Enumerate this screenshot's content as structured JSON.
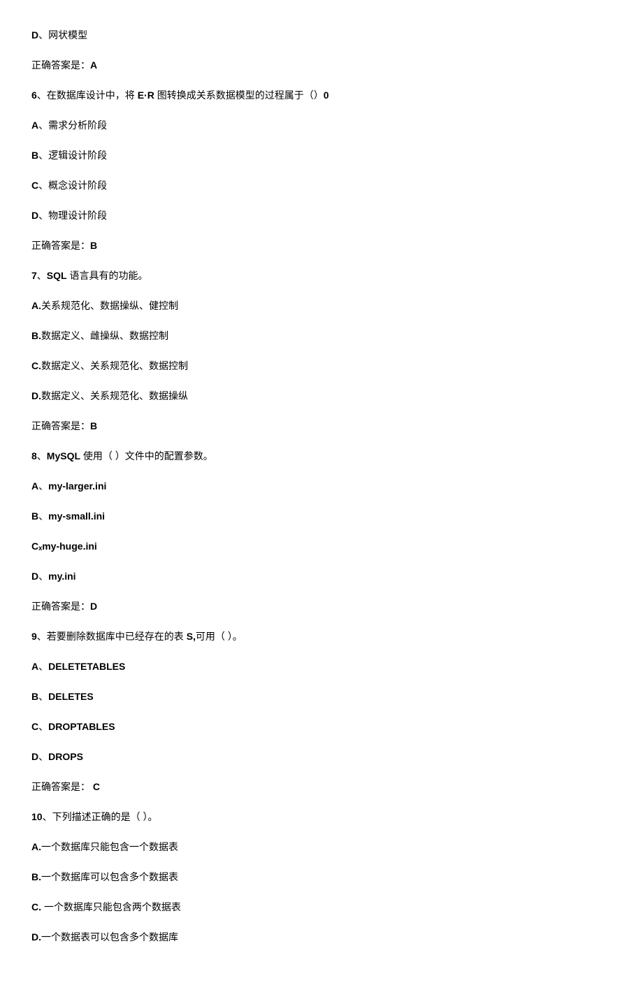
{
  "lines": [
    {
      "segments": [
        {
          "text": "D",
          "bold": true
        },
        {
          "text": "、网状模型"
        }
      ]
    },
    {
      "segments": [
        {
          "text": "正确答案是："
        },
        {
          "text": "A",
          "bold": true
        }
      ]
    },
    {
      "segments": [
        {
          "text": "6",
          "bold": true
        },
        {
          "text": "、在数据库设计中，将 "
        },
        {
          "text": "E·R",
          "bold": true
        },
        {
          "text": " 图转换成关系数据模型的过程属于（）"
        },
        {
          "text": "0",
          "bold": true
        }
      ]
    },
    {
      "segments": [
        {
          "text": "A",
          "bold": true
        },
        {
          "text": "、需求分析阶段"
        }
      ]
    },
    {
      "segments": [
        {
          "text": "B",
          "bold": true
        },
        {
          "text": "、逻辑设计阶段"
        }
      ]
    },
    {
      "segments": [
        {
          "text": "C",
          "bold": true
        },
        {
          "text": "、概念设计阶段"
        }
      ]
    },
    {
      "segments": [
        {
          "text": "D",
          "bold": true
        },
        {
          "text": "、物理设计阶段"
        }
      ]
    },
    {
      "segments": [
        {
          "text": "正确答案是："
        },
        {
          "text": "B",
          "bold": true
        }
      ]
    },
    {
      "segments": [
        {
          "text": "7",
          "bold": true
        },
        {
          "text": "、"
        },
        {
          "text": "SQL",
          "bold": true
        },
        {
          "text": " 语言具有的功能。"
        }
      ]
    },
    {
      "segments": [
        {
          "text": "A.",
          "bold": true
        },
        {
          "text": "关系规范化、数据操纵、健控制"
        }
      ]
    },
    {
      "segments": [
        {
          "text": "B.",
          "bold": true
        },
        {
          "text": "数据定义、雌操纵、数据控制"
        }
      ]
    },
    {
      "segments": [
        {
          "text": "C.",
          "bold": true
        },
        {
          "text": "数据定义、关系规范化、数据控制"
        }
      ]
    },
    {
      "segments": [
        {
          "text": "D.",
          "bold": true
        },
        {
          "text": "数据定义、关系规范化、数据操纵"
        }
      ]
    },
    {
      "segments": [
        {
          "text": "正确答案是："
        },
        {
          "text": "B",
          "bold": true
        }
      ]
    },
    {
      "segments": [
        {
          "text": "8",
          "bold": true
        },
        {
          "text": "、"
        },
        {
          "text": "MySQL",
          "bold": true
        },
        {
          "text": " 使用（ ）文件中的配置参数。"
        }
      ]
    },
    {
      "segments": [
        {
          "text": "A",
          "bold": true
        },
        {
          "text": "、"
        },
        {
          "text": "my-larger.ini",
          "bold": true
        }
      ]
    },
    {
      "segments": [
        {
          "text": "B",
          "bold": true
        },
        {
          "text": "、"
        },
        {
          "text": "my-small.ini",
          "bold": true
        }
      ]
    },
    {
      "segments": [
        {
          "text": "Cₓmy-huge.ini",
          "bold": true
        }
      ]
    },
    {
      "segments": [
        {
          "text": "D",
          "bold": true
        },
        {
          "text": "、"
        },
        {
          "text": "my.ini",
          "bold": true
        }
      ]
    },
    {
      "segments": [
        {
          "text": "正确答案是："
        },
        {
          "text": "D",
          "bold": true
        }
      ]
    },
    {
      "segments": [
        {
          "text": "9",
          "bold": true
        },
        {
          "text": "、若要删除数据库中已经存在的表 "
        },
        {
          "text": "S,",
          "bold": true
        },
        {
          "text": "可用（ ）。"
        }
      ]
    },
    {
      "segments": [
        {
          "text": "A",
          "bold": true
        },
        {
          "text": "、"
        },
        {
          "text": "DELETETABLES",
          "bold": true
        }
      ]
    },
    {
      "segments": [
        {
          "text": "B",
          "bold": true
        },
        {
          "text": "、"
        },
        {
          "text": "DELETES",
          "bold": true
        }
      ]
    },
    {
      "segments": [
        {
          "text": "C",
          "bold": true
        },
        {
          "text": "、"
        },
        {
          "text": "DROPTABLES",
          "bold": true
        }
      ]
    },
    {
      "segments": [
        {
          "text": "D",
          "bold": true
        },
        {
          "text": "、"
        },
        {
          "text": "DROPS",
          "bold": true
        }
      ]
    },
    {
      "segments": [
        {
          "text": "正确答案是： "
        },
        {
          "text": "C",
          "bold": true
        }
      ]
    },
    {
      "segments": [
        {
          "text": "10",
          "bold": true
        },
        {
          "text": "、下列描述正确的是（ ）。"
        }
      ]
    },
    {
      "segments": [
        {
          "text": "A.",
          "bold": true
        },
        {
          "text": "一个数据库只能包含一个数据表"
        }
      ]
    },
    {
      "segments": [
        {
          "text": "B.",
          "bold": true
        },
        {
          "text": "一个数据库可以包含多个数据表"
        }
      ]
    },
    {
      "segments": [
        {
          "text": "C.",
          "bold": true
        },
        {
          "text": "   一个数据库只能包含两个数据表"
        }
      ]
    },
    {
      "segments": [
        {
          "text": "D.",
          "bold": true
        },
        {
          "text": "一个数据表可以包含多个数据库"
        }
      ]
    }
  ]
}
